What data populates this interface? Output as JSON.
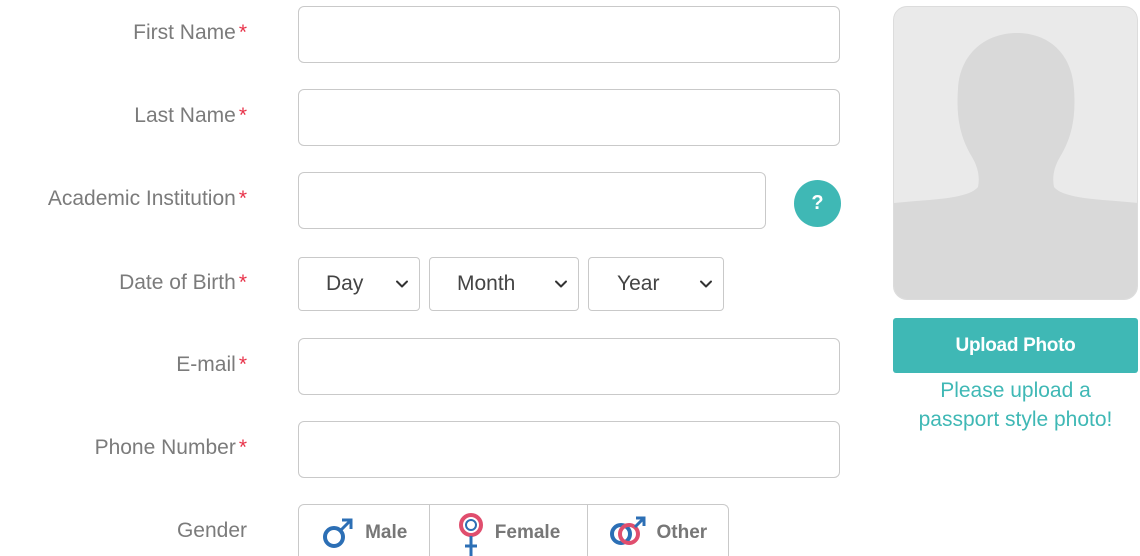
{
  "form": {
    "required_mark": "*",
    "first_name": {
      "label": "First Name",
      "value": "",
      "placeholder": ""
    },
    "last_name": {
      "label": "Last Name",
      "value": "",
      "placeholder": ""
    },
    "academic_institution": {
      "label": "Academic Institution",
      "value": "",
      "placeholder": "",
      "help": "?"
    },
    "date_of_birth": {
      "label": "Date of Birth",
      "day": "Day",
      "month": "Month",
      "year": "Year"
    },
    "email": {
      "label": "E-mail",
      "value": "",
      "placeholder": ""
    },
    "phone": {
      "label": "Phone Number",
      "value": "",
      "placeholder": ""
    },
    "gender": {
      "label": "Gender",
      "options": [
        {
          "label": "Male",
          "icon": "male-symbol-icon"
        },
        {
          "label": "Female",
          "icon": "female-symbol-icon"
        },
        {
          "label": "Other",
          "icon": "other-gender-symbol-icon"
        }
      ]
    }
  },
  "photo": {
    "upload_label": "Upload Photo",
    "note_line1": "Please upload a",
    "note_line2": "passport style photo!"
  },
  "colors": {
    "accent": "#3fb8b5",
    "required": "#e8334a",
    "label": "#7b7b7b",
    "border": "#c9c9c9",
    "male_icon": "#2c6fb5",
    "female_icon": "#e04e6e"
  }
}
